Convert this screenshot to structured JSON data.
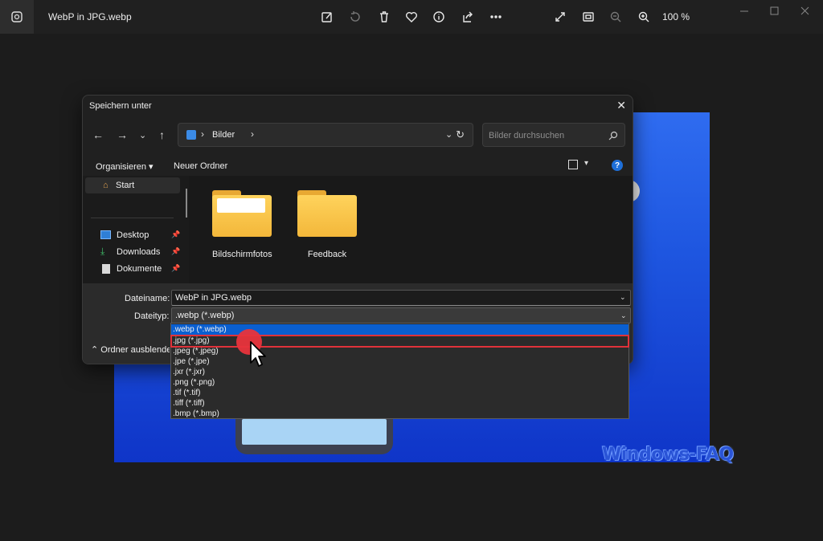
{
  "app": {
    "title": "WebP in JPG.webp",
    "zoom": "100 %"
  },
  "toolbar_icons": [
    "edit-icon",
    "rotate-icon",
    "delete-icon",
    "favorite-icon",
    "info-icon",
    "share-icon",
    "more-icon",
    "fullscreen-icon",
    "fit-icon",
    "zoom-out-icon",
    "zoom-in-icon"
  ],
  "dialog": {
    "title": "Speichern unter",
    "address": {
      "location": "Bilder"
    },
    "search_placeholder": "Bilder durchsuchen",
    "organize_label": "Organisieren ▾",
    "new_folder_label": "Neuer Ordner",
    "help_label": "?",
    "nav": {
      "start": "Start",
      "items": [
        {
          "label": "Desktop",
          "icon": "desktop-icon"
        },
        {
          "label": "Downloads",
          "icon": "download-icon"
        },
        {
          "label": "Dokumente",
          "icon": "document-icon"
        }
      ]
    },
    "folders": [
      {
        "label": "Bildschirmfotos"
      },
      {
        "label": "Feedback"
      }
    ],
    "form": {
      "filename_label": "Dateiname:",
      "filename_value": "WebP in JPG.webp",
      "filetype_label": "Dateityp:",
      "filetype_value": ".webp (*.webp)",
      "hide_folders_label": "Ordner ausblenden"
    },
    "filetype_options": [
      ".webp (*.webp)",
      ".jpg (*.jpg)",
      ".jpeg (*.jpeg)",
      ".jpe (*.jpe)",
      ".jxr (*.jxr)",
      ".png (*.png)",
      ".tif (*.tif)",
      ".tiff (*.tiff)",
      ".bmp (*.bmp)"
    ],
    "selected_option_index": 0,
    "highlighted_option_index": 1
  },
  "watermark": "Windows-FAQ",
  "colors": {
    "accent": "#0a5fd0",
    "highlight": "#e0323a",
    "folder": "#f3b73a"
  }
}
